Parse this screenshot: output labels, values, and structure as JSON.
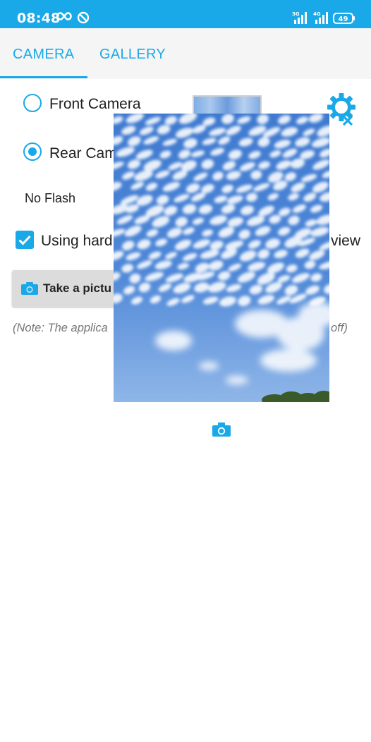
{
  "status_bar": {
    "time": "08:48",
    "icons": [
      "infinity-icon",
      "do-not-disturb-icon",
      "signal-3g-icon",
      "signal-4g-icon",
      "battery-icon"
    ],
    "signal_1_label": "3G",
    "signal_2_label": "4G",
    "battery_level": "49"
  },
  "tabs": [
    {
      "label": "CAMERA",
      "selected": true
    },
    {
      "label": "GALLERY",
      "selected": false
    }
  ],
  "camera_options": {
    "front_camera_label": "Front Camera",
    "rear_camera_label": "Rear Cam",
    "selected": "rear",
    "flash_label": "No Flash",
    "hardware_checkbox_label": "Using hard",
    "hardware_checkbox_label_tail": "view",
    "hardware_checked": true
  },
  "take_picture_button": {
    "label": "Take a pictu"
  },
  "note_left": "(Note: The applica",
  "note_right": "off)",
  "icons": {
    "settings": "gear-with-x-icon",
    "camera": "camera-icon"
  },
  "colors": {
    "accent": "#1aa9e8",
    "sky": "#4e86d6"
  }
}
